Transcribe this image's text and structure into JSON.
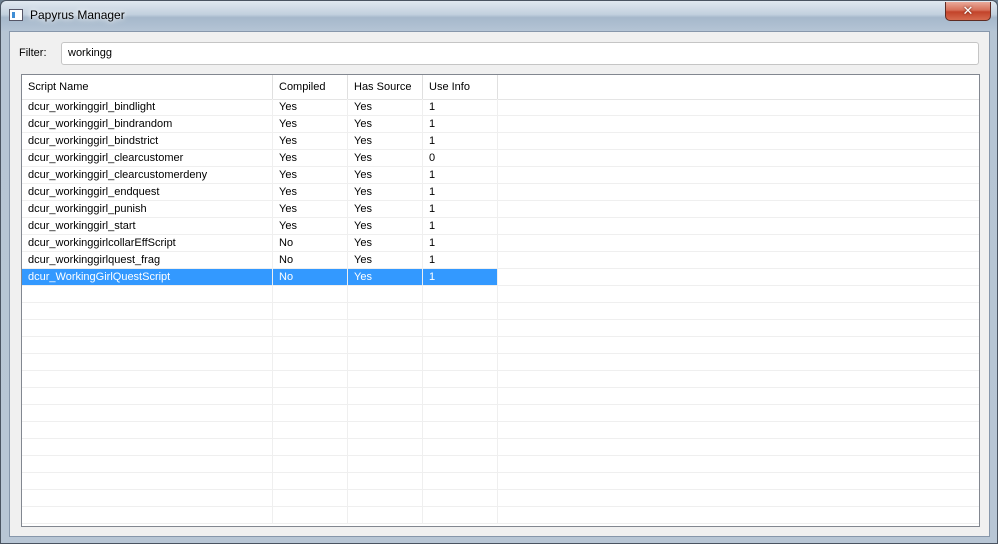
{
  "window": {
    "title": "Papyrus Manager",
    "close_symbol": "✕"
  },
  "filter": {
    "label": "Filter:",
    "value": "workingg"
  },
  "table": {
    "columns": [
      "Script Name",
      "Compiled",
      "Has Source",
      "Use Info"
    ],
    "rows": [
      [
        "dcur_workinggirl_bindlight",
        "Yes",
        "Yes",
        "1"
      ],
      [
        "dcur_workinggirl_bindrandom",
        "Yes",
        "Yes",
        "1"
      ],
      [
        "dcur_workinggirl_bindstrict",
        "Yes",
        "Yes",
        "1"
      ],
      [
        "dcur_workinggirl_clearcustomer",
        "Yes",
        "Yes",
        "0"
      ],
      [
        "dcur_workinggirl_clearcustomerdeny",
        "Yes",
        "Yes",
        "1"
      ],
      [
        "dcur_workinggirl_endquest",
        "Yes",
        "Yes",
        "1"
      ],
      [
        "dcur_workinggirl_punish",
        "Yes",
        "Yes",
        "1"
      ],
      [
        "dcur_workinggirl_start",
        "Yes",
        "Yes",
        "1"
      ],
      [
        "dcur_workinggirlcollarEffScript",
        "No",
        "Yes",
        "1"
      ],
      [
        "dcur_workinggirlquest_frag",
        "No",
        "Yes",
        "1"
      ],
      [
        "dcur_WorkingGirlQuestScript",
        "No",
        "Yes",
        "1"
      ]
    ],
    "selected_row_index": 10
  },
  "colors": {
    "selection": "#3399ff",
    "titlebar": "#c2d0de",
    "close_button": "#c2432a"
  },
  "icons": {
    "app_icon": "window-app-icon",
    "close": "close-icon"
  }
}
